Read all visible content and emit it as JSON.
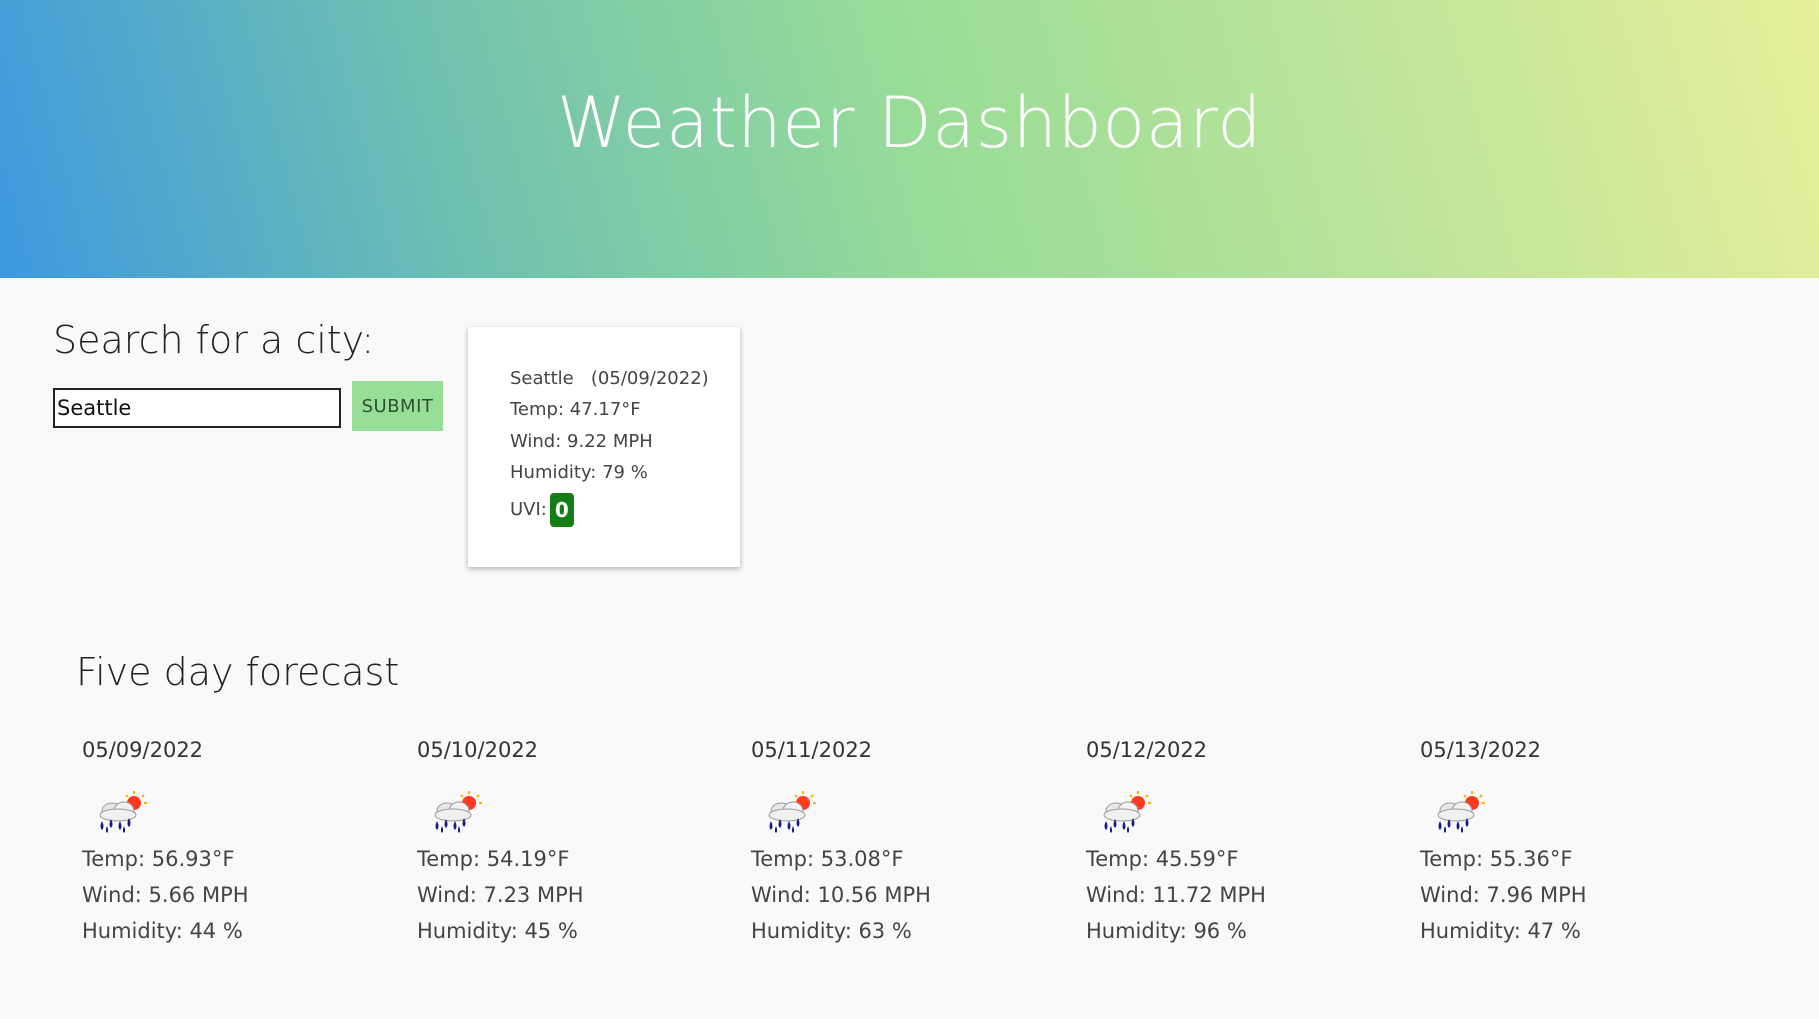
{
  "header": {
    "title": "Weather Dashboard"
  },
  "search": {
    "title": "Search for a city:",
    "value": "Seattle",
    "submit_label": "SUBMIT"
  },
  "current": {
    "city_date": "Seattle   (05/09/2022)",
    "temp": "Temp: 47.17°F",
    "wind": "Wind: 9.22 MPH",
    "humidity": "Humidity: 79 %",
    "uvi_label": "UVI:",
    "uvi_value": "0",
    "uvi_color": "#137e13"
  },
  "forecast": {
    "title": "Five day forecast",
    "icon": "rain-sun-icon",
    "days": [
      {
        "date": "05/09/2022",
        "temp": "Temp: 56.93°F",
        "wind": "Wind: 5.66 MPH",
        "humidity": "Humidity: 44 %"
      },
      {
        "date": "05/10/2022",
        "temp": "Temp: 54.19°F",
        "wind": "Wind: 7.23 MPH",
        "humidity": "Humidity: 45 %"
      },
      {
        "date": "05/11/2022",
        "temp": "Temp: 53.08°F",
        "wind": "Wind: 10.56 MPH",
        "humidity": "Humidity: 63 %"
      },
      {
        "date": "05/12/2022",
        "temp": "Temp: 45.59°F",
        "wind": "Wind: 11.72 MPH",
        "humidity": "Humidity: 96 %"
      },
      {
        "date": "05/13/2022",
        "temp": "Temp: 55.36°F",
        "wind": "Wind: 7.96 MPH",
        "humidity": "Humidity: 47 %"
      }
    ]
  },
  "colors": {
    "submit_button": "#97de97",
    "header_gradient": [
      "#3d98e0",
      "#97dc98",
      "#e6ef9a"
    ]
  }
}
